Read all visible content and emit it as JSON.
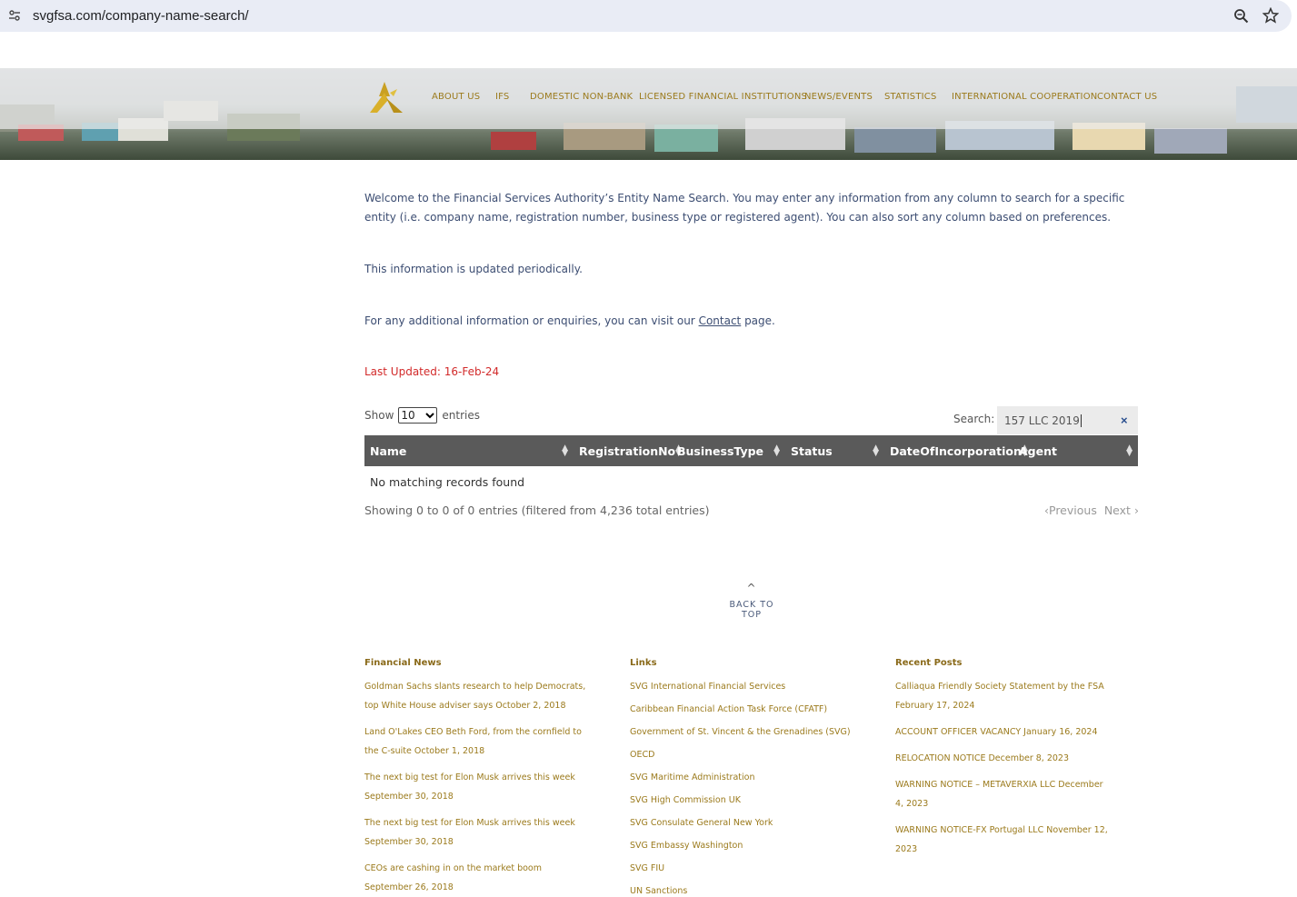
{
  "browser": {
    "url": "svgfsa.com/company-name-search/"
  },
  "nav": {
    "items": [
      "ABOUT US",
      "IFS",
      "DOMESTIC NON-BANK",
      "LICENSED FINANCIAL INSTITUTIONS",
      "NEWS/EVENTS",
      "STATISTICS",
      "INTERNATIONAL COOPERATION",
      "CONTACT US"
    ]
  },
  "intro": {
    "welcome": "Welcome to the Financial Services Authority’s Entity Name Search. You may enter any information from any column to search for a specific entity (i.e. company name, registration number, business type or registered agent). You can also sort any column based on preferences.",
    "updated": "This information is updated periodically.",
    "contact_prefix": "For any additional information or enquiries, you can visit our ",
    "contact_link": "Contact",
    "contact_suffix": " page.",
    "last_updated": "Last Updated:  16-Feb-24"
  },
  "table": {
    "show_label": "Show",
    "entries_value": "10",
    "entries_label": "entries",
    "search_label": "Search:",
    "search_value": "157 LLC 2019",
    "columns": [
      "Name",
      "RegistrationNo",
      "BusinessType",
      "Status",
      "DateOfIncorporation",
      "Agent"
    ],
    "empty_message": "No matching records found",
    "info": "Showing 0 to 0 of 0 entries (filtered from 4,236 total entries)",
    "prev": "Previous",
    "next": "Next"
  },
  "back_to_top": "BACK TO TOP",
  "footer": {
    "news_title": "Financial News",
    "news": [
      "Goldman Sachs slants research to help Democrats, top White House adviser says October 2, 2018",
      "Land O'Lakes CEO Beth Ford, from the cornfield to the C-suite October 1, 2018",
      "The next big test for Elon Musk arrives this week September 30, 2018",
      "The next big test for Elon Musk arrives this week September 30, 2018",
      "CEOs are cashing in on the market boom September 26, 2018"
    ],
    "links_title": "Links",
    "links": [
      "SVG International Financial Services",
      "Caribbean Financial Action Task Force (CFATF)",
      "Government of St. Vincent & the Grenadines (SVG)",
      "OECD",
      "SVG Maritime Administration",
      "SVG High Commission UK",
      "SVG Consulate General New York",
      "SVG Embassy Washington",
      "SVG FIU",
      "UN Sanctions"
    ],
    "posts_title": "Recent Posts",
    "posts": [
      "Calliaqua Friendly Society Statement by the FSA February 17, 2024",
      "ACCOUNT OFFICER VACANCY January 16, 2024",
      "RELOCATION NOTICE December 8, 2023",
      "WARNING NOTICE – METAVERXIA LLC December 4, 2023",
      "WARNING NOTICE-FX Portugal LLC November 12, 2023"
    ]
  }
}
